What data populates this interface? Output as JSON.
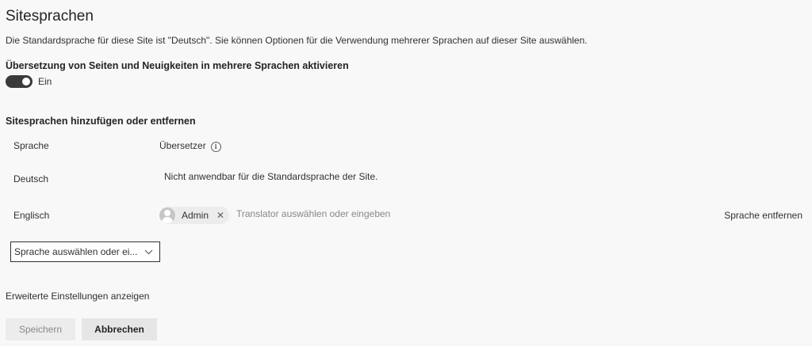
{
  "page": {
    "title": "Sitesprachen",
    "description": "Die Standardsprache für diese Site ist \"Deutsch\". Sie können Optionen für die Verwendung mehrerer Sprachen auf dieser Site auswählen."
  },
  "translation_toggle": {
    "heading": "Übersetzung von Seiten und Neuigkeiten in mehrere Sprachen aktivieren",
    "state_label": "Ein",
    "on": true
  },
  "languages_section": {
    "heading": "Sitesprachen hinzufügen oder entfernen",
    "columns": {
      "language": "Sprache",
      "translator": "Übersetzer"
    },
    "rows": [
      {
        "language": "Deutsch",
        "translator_note": "Nicht anwendbar für die Standardsprache der Site."
      },
      {
        "language": "Englisch",
        "translator_name": "Admin",
        "translator_placeholder": "Translator auswählen oder eingeben",
        "remove_label": "Sprache entfernen"
      }
    ],
    "add_language_dropdown": {
      "placeholder": "Sprache auswählen oder ei..."
    }
  },
  "advanced_link": "Erweiterte Einstellungen anzeigen",
  "actions": {
    "save_label": "Speichern",
    "cancel_label": "Abbrechen"
  },
  "icons": {
    "info": "info-icon",
    "remove": "close-icon",
    "chevron": "chevron-down-icon",
    "avatar": "person-icon"
  }
}
